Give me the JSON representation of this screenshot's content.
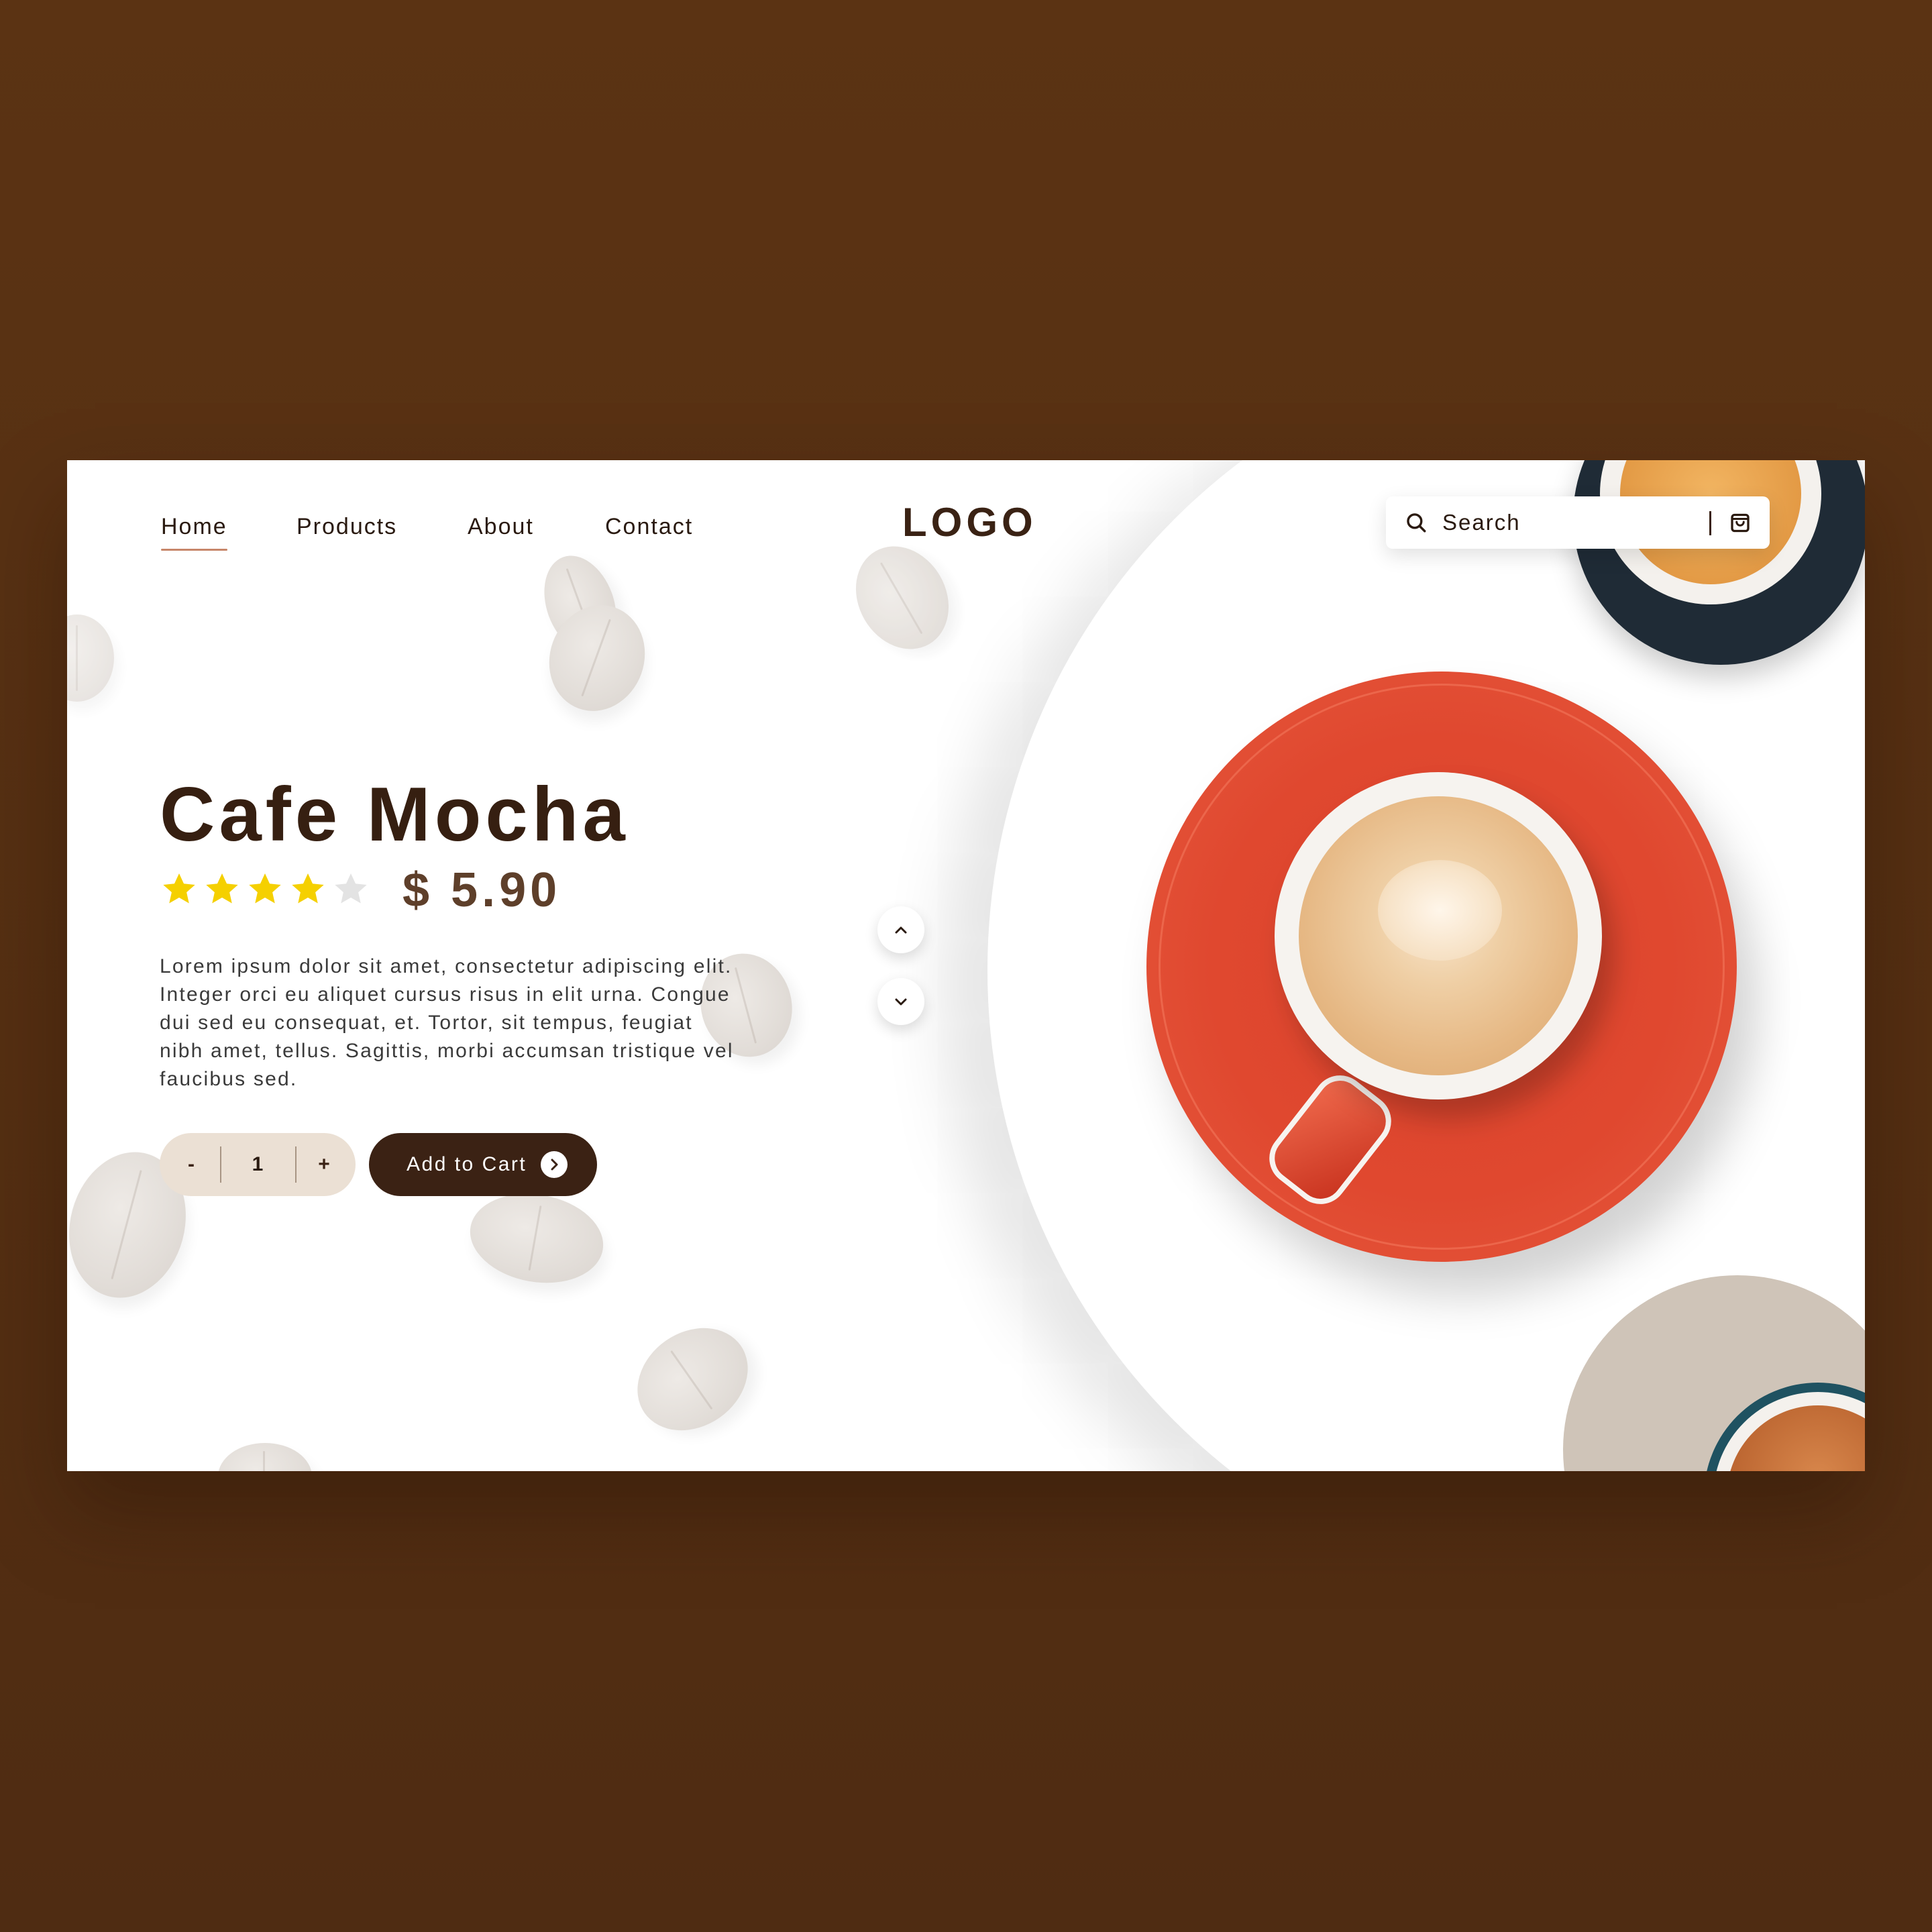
{
  "nav": {
    "items": [
      {
        "label": "Home",
        "active": true
      },
      {
        "label": "Products",
        "active": false
      },
      {
        "label": "About",
        "active": false
      },
      {
        "label": "Contact",
        "active": false
      }
    ]
  },
  "logo": "LOGO",
  "search": {
    "placeholder": "Search",
    "value": ""
  },
  "product": {
    "name": "Cafe Mocha",
    "rating": 4,
    "rating_max": 5,
    "price": "$ 5.90",
    "description": "Lorem ipsum dolor sit amet, consectetur adipiscing elit. Integer orci eu aliquet cursus risus in elit urna. Congue dui sed eu consequat, et. Tortor, sit tempus, feugiat nibh amet, tellus. Sagittis, morbi accumsan tristique vel faucibus sed."
  },
  "quantity": {
    "minus_label": "-",
    "value": "1",
    "plus_label": "+"
  },
  "add_to_cart": {
    "label": "Add to Cart"
  },
  "icons": {
    "search": "search-icon",
    "cart": "shopping-bag-icon",
    "arrow_up": "chevron-up-icon",
    "arrow_down": "chevron-down-icon",
    "add_to_cart_arrow": "chevron-right-icon",
    "star": "star-icon"
  },
  "colors": {
    "background": "#5b3313",
    "brand_dark": "#3b2214",
    "price": "#5e3f2a",
    "star_filled": "#f5d000",
    "star_empty": "#e3e3e3",
    "stepper_bg": "#ebe0d4",
    "nav_underline": "#c7866a"
  }
}
